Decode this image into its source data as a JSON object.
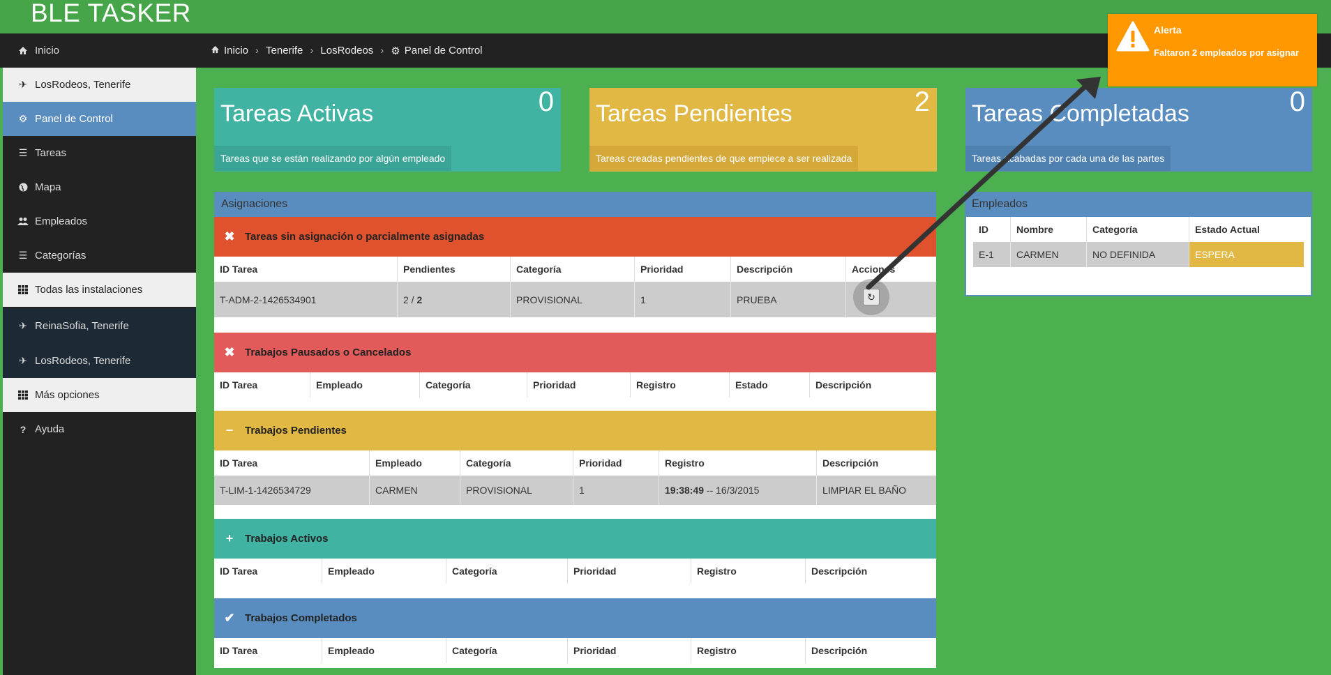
{
  "app": {
    "brand": "BLE TASKER"
  },
  "breadcrumb": [
    "Inicio",
    "Tenerife",
    "LosRodeos",
    "Panel de Control"
  ],
  "sidebar": {
    "items": [
      {
        "label": "Inicio",
        "icon": "home-icon"
      },
      {
        "label": "LosRodeos, Tenerife",
        "icon": "plane-icon"
      },
      {
        "label": "Panel de Control",
        "icon": "cogs-icon"
      },
      {
        "label": "Tareas",
        "icon": "list-icon"
      },
      {
        "label": "Mapa",
        "icon": "globe-icon"
      },
      {
        "label": "Empleados",
        "icon": "users-icon"
      },
      {
        "label": "Categorías",
        "icon": "list-icon"
      },
      {
        "label": "Todas las instalaciones",
        "icon": "grid-icon"
      },
      {
        "label": "ReinaSofia, Tenerife",
        "icon": "plane-icon"
      },
      {
        "label": "LosRodeos, Tenerife",
        "icon": "plane-icon"
      },
      {
        "label": "Más opciones",
        "icon": "grid-icon"
      },
      {
        "label": "Ayuda",
        "icon": "question-icon"
      }
    ]
  },
  "cards": [
    {
      "title": "Tareas Activas",
      "count": "0",
      "desc": "Tareas que se están realizando por algún empleado",
      "color": "#41b3a3"
    },
    {
      "title": "Tareas Pendientes",
      "count": "2",
      "desc": "Tareas creadas pendientes de que empiece a ser realizada",
      "color": "#e0b843"
    },
    {
      "title": "Tareas Completadas",
      "count": "0",
      "desc": "Tareas acabadas por cada una de las partes",
      "color": "#5a8dbf"
    }
  ],
  "asignaciones": {
    "title": "Asignaciones",
    "sin_asignacion": {
      "title": "Tareas sin asignación o parcialmente asignadas",
      "headers": [
        "ID Tarea",
        "Pendientes",
        "Categoría",
        "Prioridad",
        "Descripción",
        "Acciones"
      ],
      "row": {
        "id": "T-ADM-2-1426534901",
        "pend_a": "2",
        "pend_sep": " / ",
        "pend_b": "2",
        "cat": "PROVISIONAL",
        "prio": "1",
        "desc": "PRUEBA"
      }
    },
    "pausados": {
      "title": "Trabajos Pausados o Cancelados",
      "headers": [
        "ID Tarea",
        "Empleado",
        "Categoría",
        "Prioridad",
        "Registro",
        "Estado",
        "Descripción"
      ]
    },
    "pendientes": {
      "title": "Trabajos Pendientes",
      "headers": [
        "ID Tarea",
        "Empleado",
        "Categoría",
        "Prioridad",
        "Registro",
        "Descripción"
      ],
      "row": {
        "id": "T-LIM-1-1426534729",
        "emp": "CARMEN",
        "cat": "PROVISIONAL",
        "prio": "1",
        "time": "19:38:49",
        "date": " -- 16/3/2015",
        "desc": "LIMPIAR EL BAÑO"
      }
    },
    "activos": {
      "title": "Trabajos Activos",
      "headers": [
        "ID Tarea",
        "Empleado",
        "Categoría",
        "Prioridad",
        "Registro",
        "Descripción"
      ]
    },
    "completados": {
      "title": "Trabajos Completados",
      "headers": [
        "ID Tarea",
        "Empleado",
        "Categoría",
        "Prioridad",
        "Registro",
        "Descripción"
      ]
    }
  },
  "empleados": {
    "title": "Empleados",
    "headers": [
      "ID",
      "Nombre",
      "Categoría",
      "Estado Actual"
    ],
    "row": {
      "id": "E-1",
      "name": "CARMEN",
      "cat": "NO DEFINIDA",
      "state": "ESPERA"
    }
  },
  "alert": {
    "title": "Alerta",
    "message": "Faltaron 2 empleados por asignar"
  },
  "colors": {
    "sin_asig": "#e0522e",
    "pausados": "#e25a5a",
    "pendientes": "#e0b843",
    "activos": "#41b3a3",
    "completados": "#5a8dbf",
    "alert": "#ff9800"
  }
}
